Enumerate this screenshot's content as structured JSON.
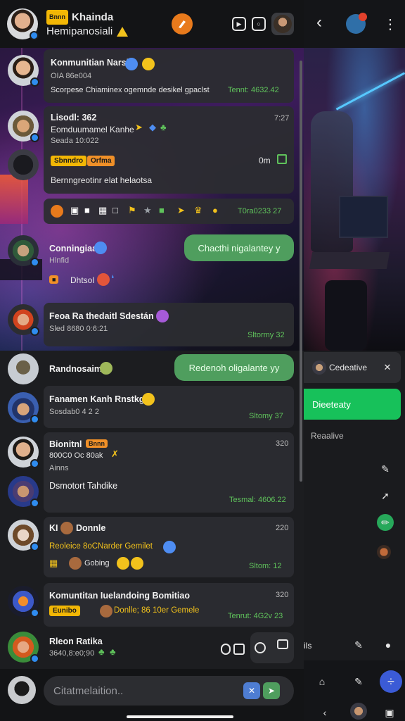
{
  "header": {
    "badge": "Bnnn",
    "title": "Khainda",
    "subtitle": "Hemipanosiali"
  },
  "messages": [
    {
      "name": "Konmunitian Narsjo",
      "line2": "OIA 86e004",
      "line3": "Scorpese Chiaminex ogemnde desikel gpaclst",
      "time": "Tennt: 4632.42"
    },
    {
      "name": "Lisodl: 362",
      "line2": "Eomduumamel Kanhe",
      "line3": "Seada 10:022",
      "chips": [
        "Sbnndro",
        "Orfma"
      ],
      "right_text": "0m",
      "line5": "Bernngreotinr elat helaotsa",
      "num": "7:27"
    },
    {
      "icons_time": "T0ra0233 27"
    },
    {
      "name": "Conningiaa",
      "line2": "Hlnfid",
      "chip": "Dhtsol",
      "bubble": "Chacthi nigalantey y"
    },
    {
      "name": "Feoa Ra thedaitl Sdestán",
      "line2": "Sled 8680 0:6:21",
      "time": "Sltormy 32"
    },
    {
      "name": "Randnosaim",
      "bubble": "Redenoh oligalante yy"
    },
    {
      "name": "Fanamen Kanh Rnstkgo",
      "line2": "Sosdab0 4 2 2",
      "time": "Sltomy 37"
    },
    {
      "name": "Bionitnl",
      "chip": "Bnnn",
      "line2": "800C0 Oc 80ak",
      "line3": "Ainns",
      "name2": "Dsmotort Tahdike",
      "num": "320",
      "time": "Tesmal: 4606.22"
    },
    {
      "name": "KI",
      "name_b": "Donnle",
      "line2": "Reoleice 8oCNarder Gemilet",
      "line3": "Gobing",
      "num": "220",
      "time": "Sltom: 12"
    },
    {
      "name": "Komuntitan Iuelandoing Bomitiao",
      "chip": "Eunibo",
      "line2": "Donlle; 86 10er Gemele",
      "num": "320",
      "time": "Tenrut: 4G2v 23"
    },
    {
      "name": "Rleon Ratika",
      "line2": "3640,8:e0;90"
    }
  ],
  "input": {
    "placeholder": "Citatmelaition.."
  },
  "right": {
    "chip_label": "Cedeative",
    "green_label": "Dieeteaty",
    "label": "Reaalive",
    "bottom_label": "ils"
  },
  "colors": {
    "accent_green": "#5fc25b",
    "bubble_green": "#4f9e5e",
    "bright_green": "#17c15a",
    "brand_orange": "#e87a1c",
    "chip_yellow": "#f2b705"
  }
}
